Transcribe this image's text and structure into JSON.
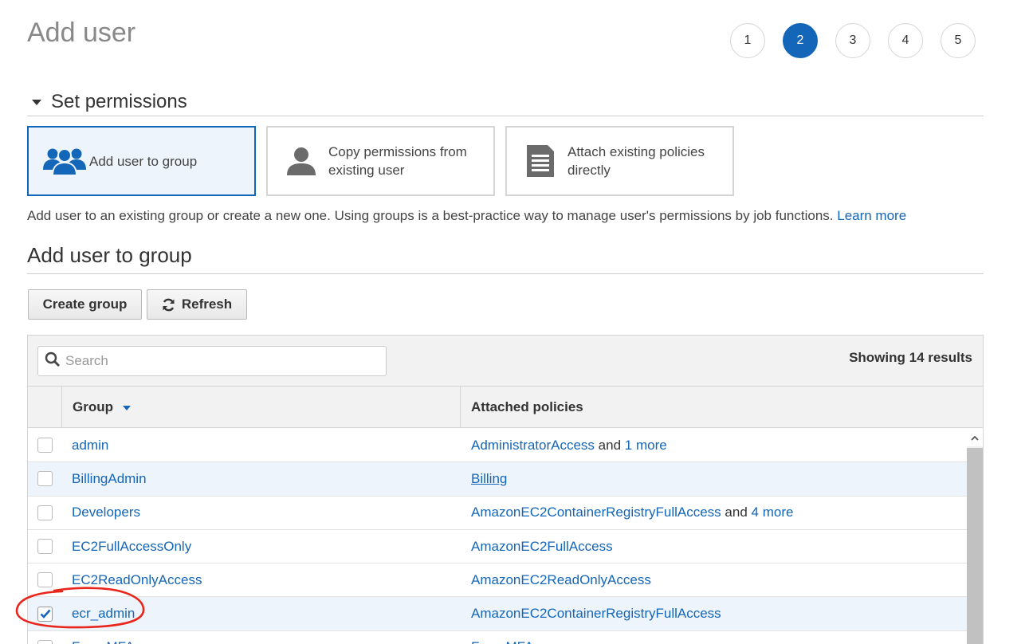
{
  "page": {
    "title": "Add user"
  },
  "steps": [
    "1",
    "2",
    "3",
    "4",
    "5"
  ],
  "steps_active": "2",
  "permissions": {
    "heading": "Set permissions",
    "options": [
      {
        "label_line1": "Add user to group",
        "label_line2": "",
        "icon": "users-group-icon",
        "selected": true
      },
      {
        "label_line1": "Copy permissions from",
        "label_line2": "existing user",
        "icon": "user-icon",
        "selected": false
      },
      {
        "label_line1": "Attach existing policies",
        "label_line2": "directly",
        "icon": "document-icon",
        "selected": false
      }
    ],
    "description": "Add user to an existing group or create a new one. Using groups is a best-practice way to manage user's permissions by job functions.",
    "learn_more": "Learn more"
  },
  "group_section": {
    "heading": "Add user to group",
    "create_button": "Create group",
    "refresh_button": "Refresh",
    "search_placeholder": "Search",
    "results_text": "Showing 14 results",
    "columns": {
      "group": "Group",
      "policies": "Attached policies"
    },
    "rows": [
      {
        "group": "admin",
        "policy": "AdministratorAccess",
        "and": "and",
        "more": "1 more",
        "checked": false
      },
      {
        "group": "BillingAdmin",
        "policy": "Billing",
        "and": "",
        "more": "",
        "checked": false
      },
      {
        "group": "Developers",
        "policy": "AmazonEC2ContainerRegistryFullAccess",
        "and": "and",
        "more": "4 more",
        "checked": false
      },
      {
        "group": "EC2FullAccessOnly",
        "policy": "AmazonEC2FullAccess",
        "and": "",
        "more": "",
        "checked": false
      },
      {
        "group": "EC2ReadOnlyAccess",
        "policy": "AmazonEC2ReadOnlyAccess",
        "and": "",
        "more": "",
        "checked": false
      },
      {
        "group": "ecr_admin",
        "policy": "AmazonEC2ContainerRegistryFullAccess",
        "and": "",
        "more": "",
        "checked": true
      },
      {
        "group": "ForceMFA",
        "policy": "ForceMFA",
        "and": "",
        "more": "",
        "checked": false
      }
    ]
  },
  "colors": {
    "accent": "#1466b8",
    "annotation": "#e8261b",
    "highlight_row": "#eef4fb"
  }
}
